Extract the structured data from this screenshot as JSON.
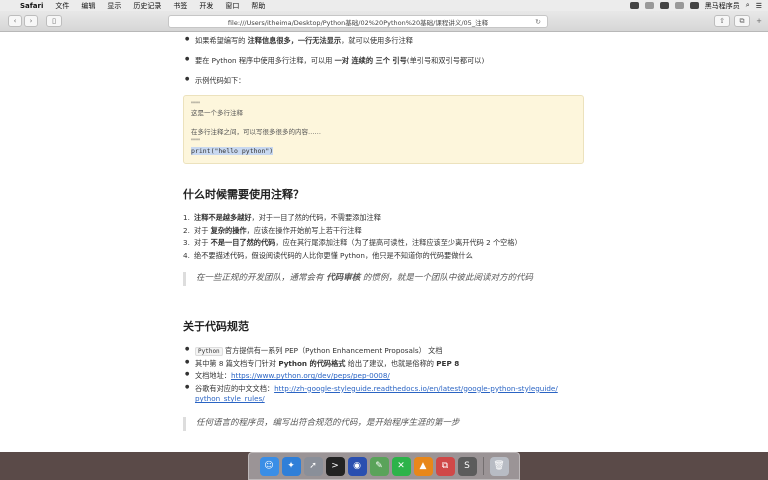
{
  "menubar": {
    "items": [
      "Safari",
      "文件",
      "编辑",
      "显示",
      "历史记录",
      "书签",
      "开发",
      "窗口",
      "帮助"
    ],
    "right_label": "黑马程序员"
  },
  "browser": {
    "address": "file:///Users/itheima/Desktop/Python基础/02%20Python%20基础/课程讲义/05_注释"
  },
  "content": {
    "bullets_top": [
      {
        "a": "如果希望编写的 ",
        "b": "注释信息很多，一行无法显示",
        "c": "，就可以使用多行注释"
      },
      {
        "a": "要在 Python 程序中使用多行注释，可以用 ",
        "b": "一对 连续的 三个 引号",
        "c": "(单引号和双引号都可以)"
      },
      {
        "a": "示例代码如下：",
        "b": "",
        "c": ""
      }
    ],
    "code_lines": [
      "\"\"\"",
      "这是一个多行注释",
      "",
      "在多行注释之间，可以写很多很多的内容……",
      "\"\"\"",
      "print(\"hello python\")"
    ],
    "h2_when": "什么时候需要使用注释？",
    "numbered": [
      {
        "n": "1.",
        "a": "",
        "b": "注释不是越多越好",
        "c": "，对于一目了然的代码，不需要添加注释"
      },
      {
        "n": "2.",
        "a": "对于 ",
        "b": "复杂的操作",
        "c": "，应该在操作开始前写上若干行注释"
      },
      {
        "n": "3.",
        "a": "对于 ",
        "b": "不是一目了然的代码",
        "c": "，应在其行尾添加注释（为了提高可读性，注释应该至少离开代码 2 个空格）"
      },
      {
        "n": "4.",
        "a": "",
        "b": "",
        "c": "绝不要描述代码，假设阅读代码的人比你更懂 Python，他只是不知道你的代码要做什么"
      }
    ],
    "quote1": {
      "a": "在一些正规的开发团队，通常会有 ",
      "b": "代码审核",
      "c": " 的惯例，就是一个团队中彼此阅读对方的代码"
    },
    "h2_pep": "关于代码规范",
    "pep_items": {
      "i1_code": "Python",
      "i1_text": " 官方提供有一系列 PEP（Python Enhancement Proposals） 文档",
      "i2_a": "其中第 8 篇文档专门针对 ",
      "i2_b": "Python 的代码格式",
      "i2_c": " 给出了建议，也就是俗称的 ",
      "i2_d": "PEP 8",
      "i3_label": "文档地址：",
      "i3_link": "https://www.python.org/dev/peps/pep-0008/",
      "i4_label": "谷歌有对应的中文文档：",
      "i4_link1": "http://zh-google-styleguide.readthedocs.io/en/latest/google-python-styleguide/",
      "i4_link2": "python_style_rules/"
    },
    "quote2": "任何语言的程序员，编写出符合规范的代码，是开始程序生涯的第一步"
  },
  "dock": {
    "apps": [
      {
        "icon": "finder-icon",
        "color": "#3a8ee6",
        "glyph": "☺"
      },
      {
        "icon": "safari-icon",
        "color": "#2f7fd8",
        "glyph": "✦"
      },
      {
        "icon": "rocket-icon",
        "color": "#8a8f99",
        "glyph": "➚"
      },
      {
        "icon": "terminal-icon",
        "color": "#222222",
        "glyph": ">"
      },
      {
        "icon": "screen-recorder-icon",
        "color": "#2a4fb0",
        "glyph": "◉"
      },
      {
        "icon": "editor-icon",
        "color": "#5aa35a",
        "glyph": "✎"
      },
      {
        "icon": "xmind-icon",
        "color": "#2db34a",
        "glyph": "✕"
      },
      {
        "icon": "vlc-icon",
        "color": "#e8871a",
        "glyph": "▲"
      },
      {
        "icon": "sequel-icon",
        "color": "#d04848",
        "glyph": "⧉"
      },
      {
        "icon": "sublime-icon",
        "color": "#5c5c5c",
        "glyph": "S"
      },
      {
        "icon": "trash-icon",
        "color": "#b8bcc4",
        "glyph": "🗑"
      }
    ]
  }
}
